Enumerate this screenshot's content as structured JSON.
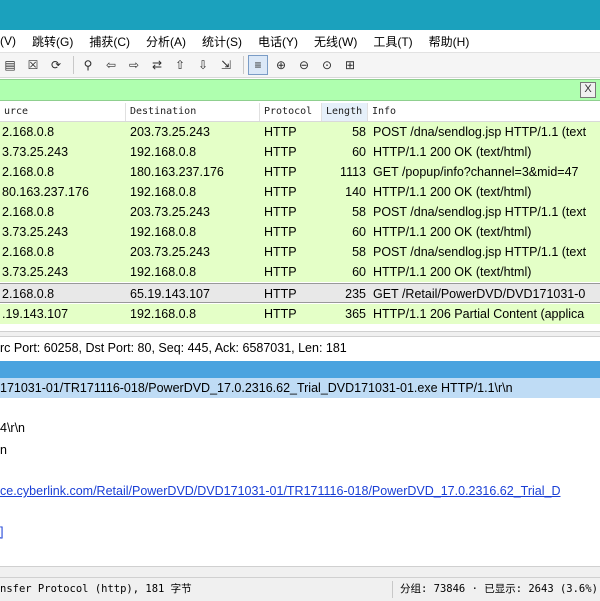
{
  "menu": [
    "(V)",
    "跳转(G)",
    "捕获(C)",
    "分析(A)",
    "统计(S)",
    "电话(Y)",
    "无线(W)",
    "工具(T)",
    "帮助(H)"
  ],
  "toolbar_icons": [
    "capture-options-icon",
    "close-file-icon",
    "reload-icon",
    "find-packet-icon",
    "go-back-icon",
    "go-forward-icon",
    "go-to-packet-icon",
    "go-first-icon",
    "go-last-icon",
    "autoscroll-icon",
    "colorize-icon",
    "zoom-in-icon",
    "zoom-out-icon",
    "zoom-reset-icon",
    "resize-columns-icon"
  ],
  "filter": {
    "close_label": "X"
  },
  "columns": {
    "source": "urce",
    "destination": "Destination",
    "protocol": "Protocol",
    "length": "Length",
    "info": "Info"
  },
  "packets": [
    {
      "source": "2.168.0.8",
      "destination": "203.73.25.243",
      "protocol": "HTTP",
      "length": "58",
      "info": "POST /dna/sendlog.jsp HTTP/1.1  (text"
    },
    {
      "source": "3.73.25.243",
      "destination": "192.168.0.8",
      "protocol": "HTTP",
      "length": "60",
      "info": "HTTP/1.1 200 OK  (text/html)"
    },
    {
      "source": "2.168.0.8",
      "destination": "180.163.237.176",
      "protocol": "HTTP",
      "length": "1113",
      "info": "GET /popup/info?channel=3&mid=47"
    },
    {
      "source": "80.163.237.176",
      "destination": "192.168.0.8",
      "protocol": "HTTP",
      "length": "140",
      "info": "HTTP/1.1 200 OK  (text/html)"
    },
    {
      "source": "2.168.0.8",
      "destination": "203.73.25.243",
      "protocol": "HTTP",
      "length": "58",
      "info": "POST /dna/sendlog.jsp HTTP/1.1  (text"
    },
    {
      "source": "3.73.25.243",
      "destination": "192.168.0.8",
      "protocol": "HTTP",
      "length": "60",
      "info": "HTTP/1.1 200 OK  (text/html)"
    },
    {
      "source": "2.168.0.8",
      "destination": "203.73.25.243",
      "protocol": "HTTP",
      "length": "58",
      "info": "POST /dna/sendlog.jsp HTTP/1.1  (text"
    },
    {
      "source": "3.73.25.243",
      "destination": "192.168.0.8",
      "protocol": "HTTP",
      "length": "60",
      "info": "HTTP/1.1 200 OK  (text/html)"
    },
    {
      "source": "2.168.0.8",
      "destination": "65.19.143.107",
      "protocol": "HTTP",
      "length": "235",
      "info": "GET /Retail/PowerDVD/DVD171031-0"
    },
    {
      "source": ".19.143.107",
      "destination": "192.168.0.8",
      "protocol": "HTTP",
      "length": "365",
      "info": "HTTP/1.1 206 Partial Content  (applica"
    }
  ],
  "selected_index": 8,
  "details": {
    "tcp": "rc Port: 60258, Dst Port: 80, Seq: 445, Ack: 6587031, Len: 181",
    "request_line": "171031-01/TR171116-018/PowerDVD_17.0.2316.62_Trial_DVD171031-01.exe HTTP/1.1\\r\\n",
    "line1": "4\\r\\n",
    "line2": "n",
    "full_uri": "ce.cyberlink.com/Retail/PowerDVD/DVD171031-01/TR171116-018/PowerDVD_17.0.2316.62_Trial_D",
    "bracket": "]"
  },
  "status": {
    "left": "nsfer Protocol (http), 181 字节",
    "right": "分组: 73846 · 已显示: 2643 (3.6%)"
  },
  "colors": {
    "title": "#1ba1bd",
    "row_bg": "#e4ffc7",
    "filter_bg": "#afffaf",
    "http_header": "#4aa3df",
    "selected_detail": "#bfdcf5",
    "link": "#1a3fd6"
  }
}
